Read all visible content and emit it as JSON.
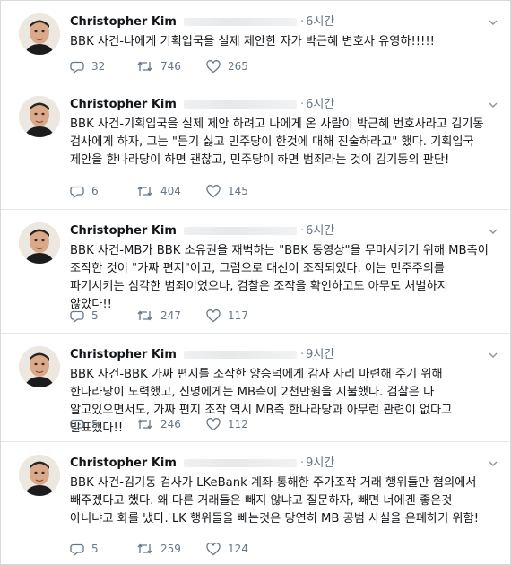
{
  "tweets": [
    {
      "author": "Christopher Kim",
      "time": "6시간",
      "text": "BBK 사건-나에게 기획입국을 실제 제안한 자가 박근혜 변호사 유영하!!!!!",
      "replies": "32",
      "retweets": "746",
      "likes": "265"
    },
    {
      "author": "Christopher Kim",
      "time": "6시간",
      "text": "BBK 사건-기획입국을 실제 제안 하려고 나에게 온 사람이 박근혜 번호사라고 김기동 검사에게 하자, 그는 \"듣기 싫고 민주당이 한것에 대해 진술하라고\" 했다. 기획입국 제안을 한나라당이 하면 괜찮고, 민주당이 하면 범죄라는 것이 김기동의 판단!",
      "replies": "6",
      "retweets": "404",
      "likes": "145"
    },
    {
      "author": "Christopher Kim",
      "time": "6시간",
      "text": "BBK 사건-MB가 BBK 소유권을 재벅하는 \"BBK 동영상\"을 무마시키기 위해 MB측이 조작한 것이 \"가짜 편지\"이고, 그럼으로 대선이 조작되었다. 이는 민주주의를 파기시키는 심각한 범죄이었으나, 검찰은 조작을 확인하고도 아무도 처벌하지 않았다!!",
      "replies": "5",
      "retweets": "247",
      "likes": "117"
    },
    {
      "author": "Christopher Kim",
      "time": "9시간",
      "text": "BBK 사건-BBK 가짜 편지를 조작한 양승덕에게 감사 자리 마련해 주기 위해 한나라당이 노력했고, 신명에게는 MB측이 2천만원을 지불했다. 검찰은 다 알고있으면서도, 가짜 편지 조작 역시 MB측 한나라당과 아무런 관련이 없다고 발표했다!!",
      "replies": "5",
      "retweets": "246",
      "likes": "112"
    },
    {
      "author": "Christopher Kim",
      "time": "9시간",
      "text": "BBK 사건-김기동 검사가 LKeBank 계좌 통해한 주가조작 거래 행위들만 혐의에서 빼주겠다고 했다. 왜 다른 거래들은 빼지 않냐고 질문하자, 빼면 너에겐 좋은것 아니냐고 화를 냈다. LK 행위들을 빼는것은 당연히 MB 공범 사실을 은폐하기 위함!",
      "replies": "5",
      "retweets": "259",
      "likes": "124"
    }
  ]
}
